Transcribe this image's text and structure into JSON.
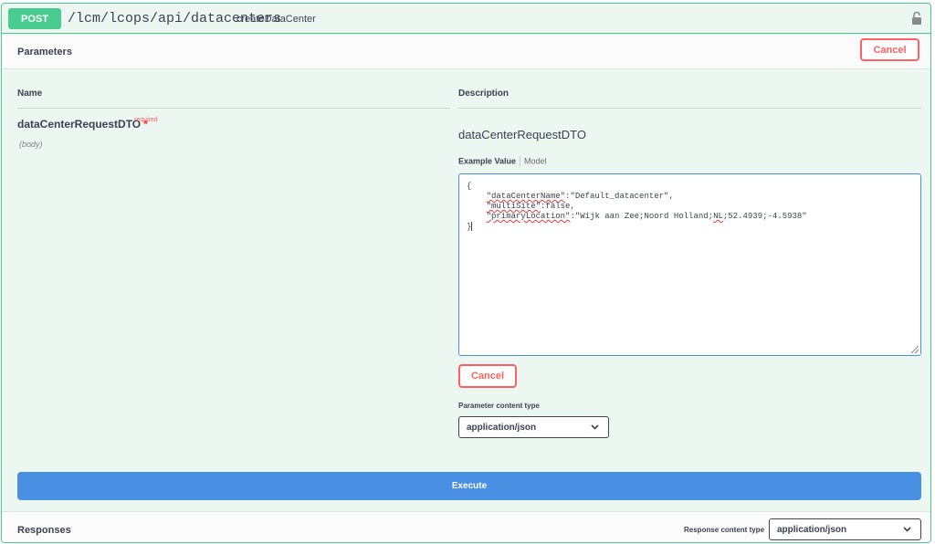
{
  "operation": {
    "method": "POST",
    "path": "/lcm/lcops/api/datacenters",
    "operation_id": "createDataCenter",
    "lock_icon": "lock-icon"
  },
  "parameters": {
    "title": "Parameters",
    "cancel_label": "Cancel",
    "col_name": "Name",
    "col_description": "Description",
    "param": {
      "name": "dataCenterRequestDTO",
      "required_star": "*",
      "required_label": "required",
      "location": "(body)",
      "schema_title": "dataCenterRequestDTO"
    },
    "tabs": {
      "example": "Example Value",
      "model": "Model"
    },
    "body": {
      "open": "{",
      "line1_key": "\"dataCenterName\"",
      "line1_val": ":\"Default_datacenter\",",
      "line2_key": "\"multiSite\"",
      "line2_val": ":false,",
      "line3_key": "\"primaryLocation\"",
      "line3_val1": ":\"Wijk aan Zee;Noord Holland;",
      "line3_nl": "NL",
      "line3_val2": ";52.4939;-4.5938\"",
      "close": "}"
    },
    "body_cancel_label": "Cancel",
    "content_type_label": "Parameter content type",
    "content_type_value": "application/json"
  },
  "execute_label": "Execute",
  "responses": {
    "title": "Responses",
    "content_type_label": "Response content type",
    "content_type_value": "application/json"
  },
  "colors": {
    "post_green": "#49cc90",
    "cancel_red": "#ff6060",
    "execute_blue": "#4990e2"
  }
}
